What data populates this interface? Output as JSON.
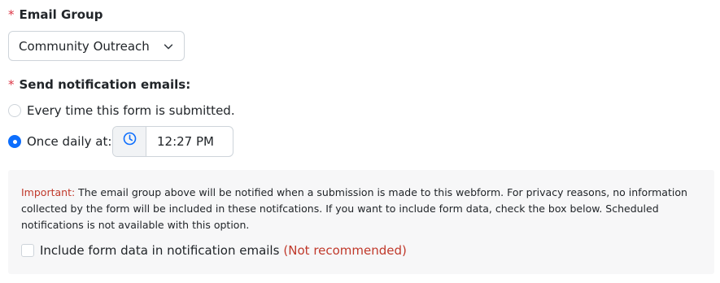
{
  "email_group": {
    "required_mark": "*",
    "label": "Email Group",
    "selected": "Community Outreach",
    "chevron_icon": "chevron-down-icon"
  },
  "notifications": {
    "required_mark": "*",
    "label": "Send notification emails:",
    "options": [
      {
        "label": "Every time this form is submitted.",
        "checked": false
      },
      {
        "label": "Once daily at:",
        "checked": true
      }
    ],
    "time": {
      "icon": "clock-icon",
      "value": "12:27 PM"
    },
    "accent_color": "#0d6efd"
  },
  "notice": {
    "important_label": "Important:",
    "text": " The email group above will be notified when a submission is made to this webform. For privacy reasons, no information collected by the form will be included in these notifcations. If you want to include form data, check the box below. Scheduled notifications is not available with this option.",
    "include_label": "Include form data in notification emails",
    "not_recommended": "(Not recommended)",
    "include_checked": false,
    "warning_color": "#c0392b"
  }
}
